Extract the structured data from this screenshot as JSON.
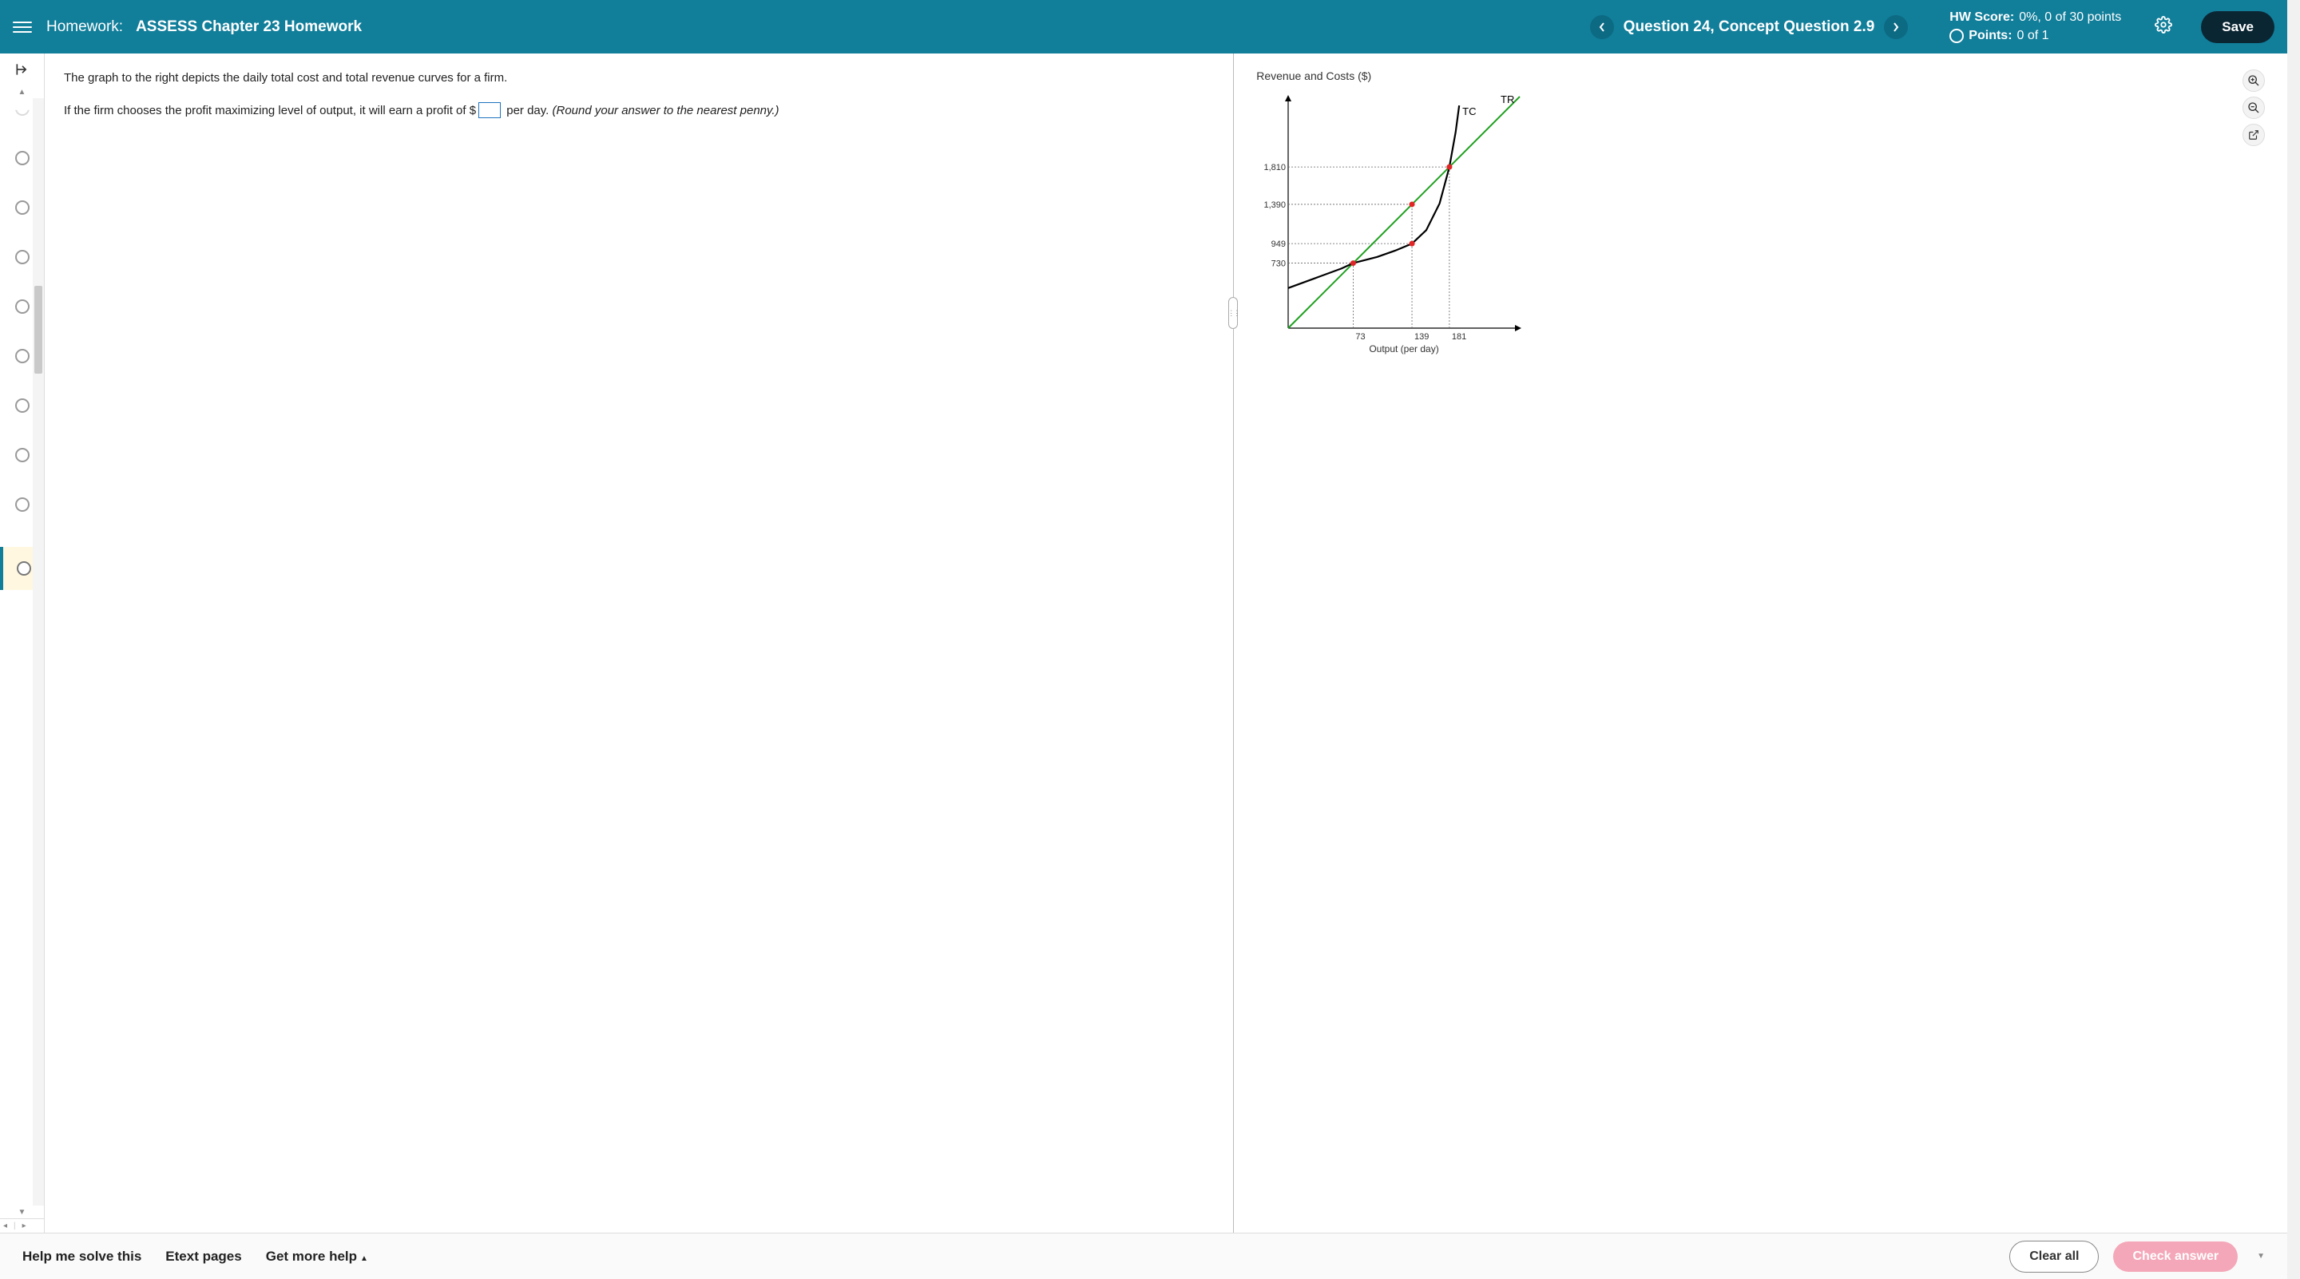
{
  "header": {
    "hw_label": "Homework:",
    "hw_title": "ASSESS Chapter 23 Homework",
    "question_title": "Question 24, Concept Question 2.9",
    "hw_score_label": "HW Score:",
    "hw_score_value": "0%, 0 of 30 points",
    "points_label": "Points:",
    "points_value": "0 of 1",
    "save_label": "Save"
  },
  "question": {
    "p1": "The graph to the right depicts the daily total cost and total revenue curves for a firm.",
    "p2_pre": "If the firm chooses the profit maximizing level of output, it will earn a profit of $",
    "p2_post": " per day.  ",
    "hint": "(Round your answer to the nearest penny.)",
    "answer": ""
  },
  "chart_data": {
    "type": "line",
    "title": "Revenue and Costs ($)",
    "xlabel": "Output (per day)",
    "ylabel": "",
    "x_range": [
      0,
      260
    ],
    "y_range": [
      0,
      2600
    ],
    "x_ticks_dotted": [
      73,
      139,
      181
    ],
    "y_ticks_dotted": [
      730,
      949,
      1390,
      1810
    ],
    "series": [
      {
        "name": "TR",
        "label": "TR",
        "color": "#1fa01f",
        "points": [
          [
            0,
            0
          ],
          [
            260,
            2600
          ]
        ]
      },
      {
        "name": "TC",
        "label": "TC",
        "color": "#000000",
        "points": [
          [
            0,
            450
          ],
          [
            30,
            560
          ],
          [
            60,
            670
          ],
          [
            73,
            730
          ],
          [
            100,
            800
          ],
          [
            120,
            870
          ],
          [
            139,
            949
          ],
          [
            155,
            1100
          ],
          [
            170,
            1400
          ],
          [
            181,
            1810
          ],
          [
            188,
            2200
          ],
          [
            192,
            2500
          ]
        ]
      }
    ],
    "markers": [
      {
        "x": 73,
        "y": 730,
        "color": "#e02626"
      },
      {
        "x": 139,
        "y": 949,
        "color": "#e02626"
      },
      {
        "x": 139,
        "y": 1390,
        "color": "#e02626"
      },
      {
        "x": 181,
        "y": 1810,
        "color": "#e02626"
      }
    ]
  },
  "footer": {
    "help_label": "Help me solve this",
    "etext_label": "Etext pages",
    "more_help_label": "Get more help",
    "clear_label": "Clear all",
    "check_label": "Check answer"
  }
}
